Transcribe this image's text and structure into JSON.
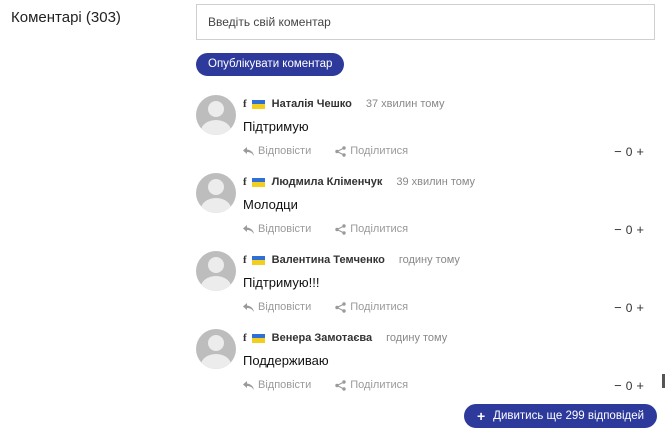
{
  "comments_header": {
    "title": "Коментарі (303)"
  },
  "input": {
    "placeholder": "Введіть свій коментар"
  },
  "publish_button": {
    "label": "Опублікувати коментар"
  },
  "comments": [
    {
      "author": "Наталія Чешко",
      "time": "37 хвилин тому",
      "text": "Підтримую",
      "reply_label": "Відповісти",
      "share_label": "Поділитися",
      "score": "0"
    },
    {
      "author": "Людмила Кліменчук",
      "time": "39 хвилин тому",
      "text": "Молодци",
      "reply_label": "Відповісти",
      "share_label": "Поділитися",
      "score": "0"
    },
    {
      "author": "Валентина Темченко",
      "time": "годину тому",
      "text": "Підтримую!!!",
      "reply_label": "Відповісти",
      "share_label": "Поділитися",
      "score": "0"
    },
    {
      "author": "Венера Замотаєва",
      "time": "годину тому",
      "text": "Поддерживаю",
      "reply_label": "Відповісти",
      "share_label": "Поділитися",
      "score": "0"
    }
  ],
  "icons": {
    "social": "facebook-icon",
    "flag": "ukraine-flag-icon",
    "reply": "reply-arrow-icon",
    "share": "share-icon"
  },
  "vote": {
    "minus": "−",
    "plus": "+"
  },
  "more_button": {
    "label": "Дивитись ще 299 відповідей",
    "icon": "+"
  },
  "colors": {
    "accent": "#2d3a9c",
    "flag_blue": "#2f6fd6",
    "flag_yellow": "#f2cf1f",
    "muted": "#9a9a9a"
  }
}
